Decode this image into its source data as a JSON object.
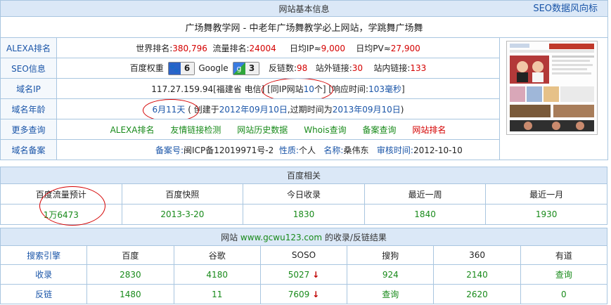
{
  "top": {
    "title": "网站基本信息",
    "seo_link": "SEO数据风向标"
  },
  "site_title": "广场舞教学网 - 中老年广场舞教学必上网站，学跳舞广场舞",
  "alexa": {
    "label": "ALEXA排名",
    "world_label": "世界排名:",
    "world": "380,796",
    "traffic_label": "流量排名:",
    "traffic": "24004",
    "ip_label": "日均IP≈",
    "ip": "9,000",
    "pv_label": "日均PV≈",
    "pv": "27,900"
  },
  "seo": {
    "label": "SEO信息",
    "baidu_label": "百度权重",
    "baidu_weight": "6",
    "google_label": "Google",
    "google_pr": "3",
    "backlink_label": "反链数:",
    "backlinks": "98",
    "outlink_label": "站外链接:",
    "outlinks": "30",
    "inlink_label": "站内链接:",
    "inlinks": "133"
  },
  "ip": {
    "label": "域名IP",
    "address": "117.27.159.94[福建省 电信]",
    "same_ip_pre": "[同IP网站",
    "same_ip_count": "10",
    "same_ip_post": "个]",
    "response_pre": "[响应时间:",
    "response": "103毫秒",
    "response_post": "]"
  },
  "age": {
    "label": "域名年龄",
    "age": "6月11天",
    "created_pre": "( 创建于",
    "created": "2012年09月10日",
    "expire_pre": ",过期时间为",
    "expire": "2013年09月10日",
    "expire_post": ")"
  },
  "more": {
    "label": "更多查询",
    "links": [
      "ALEXA排名",
      "友情链接检测",
      "网站历史数据",
      "Whois查询",
      "备案查询",
      "网站排名"
    ]
  },
  "icp": {
    "label": "域名备案",
    "no_label": "备案号:",
    "no": "闽ICP备12019971号-2",
    "nature_label": "性质:",
    "nature": "个人",
    "name_label": "名称:",
    "name": "桑伟东",
    "date_label": "审核时间:",
    "date": "2012-10-10"
  },
  "baidu": {
    "title": "百度相关",
    "headers": [
      "百度流量预计",
      "百度快照",
      "今日收录",
      "最近一周",
      "最近一月"
    ],
    "values": [
      "1万6473",
      "2013-3-20",
      "1830",
      "1840",
      "1930"
    ]
  },
  "search": {
    "title_pre": "网站",
    "domain": "www.gcwu123.com",
    "title_post": "的收录/反链结果",
    "headers": [
      "搜索引擎",
      "百度",
      "谷歌",
      "SOSO",
      "搜狗",
      "360",
      "有道"
    ],
    "rows": [
      {
        "label": "收录",
        "values": [
          "2830",
          "4180",
          "5027",
          "924",
          "2140",
          "查询"
        ]
      },
      {
        "label": "反链",
        "values": [
          "1480",
          "11",
          "7609",
          "查询",
          "2620",
          "0"
        ]
      }
    ]
  },
  "colors": {
    "accent": "#1a55a8",
    "red": "#d40000",
    "green": "#188a1a",
    "header_bg": "#dbe8f7"
  }
}
